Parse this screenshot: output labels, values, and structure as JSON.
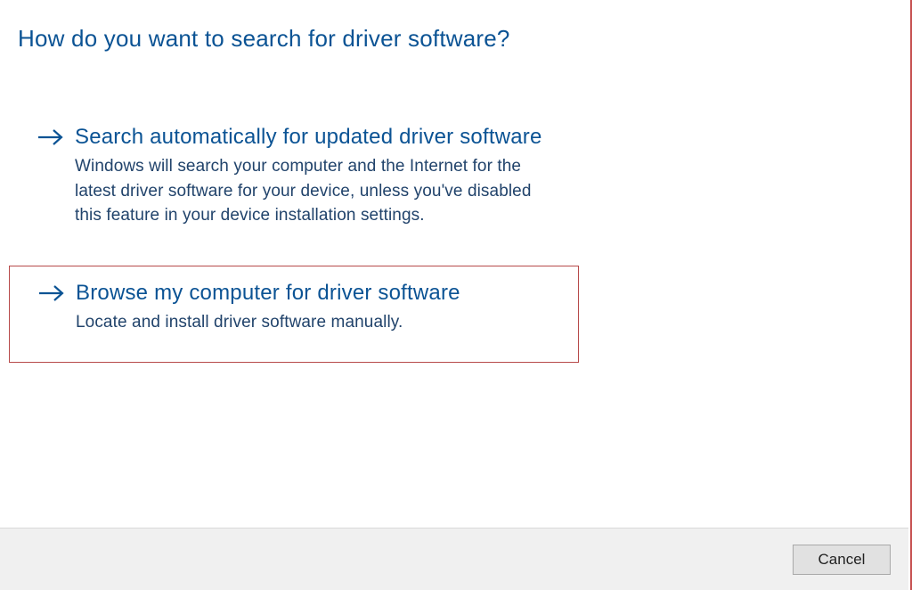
{
  "title": "How do you want to search for driver software?",
  "options": [
    {
      "label": "Search automatically for updated driver software",
      "description": "Windows will search your computer and the Internet for the latest driver software for your device, unless you've disabled this feature in your device installation settings."
    },
    {
      "label": "Browse my computer for driver software",
      "description": "Locate and install driver software manually."
    }
  ],
  "footer": {
    "cancel_label": "Cancel"
  },
  "colors": {
    "link": "#0b5394",
    "highlight_border": "#b74a4a"
  }
}
